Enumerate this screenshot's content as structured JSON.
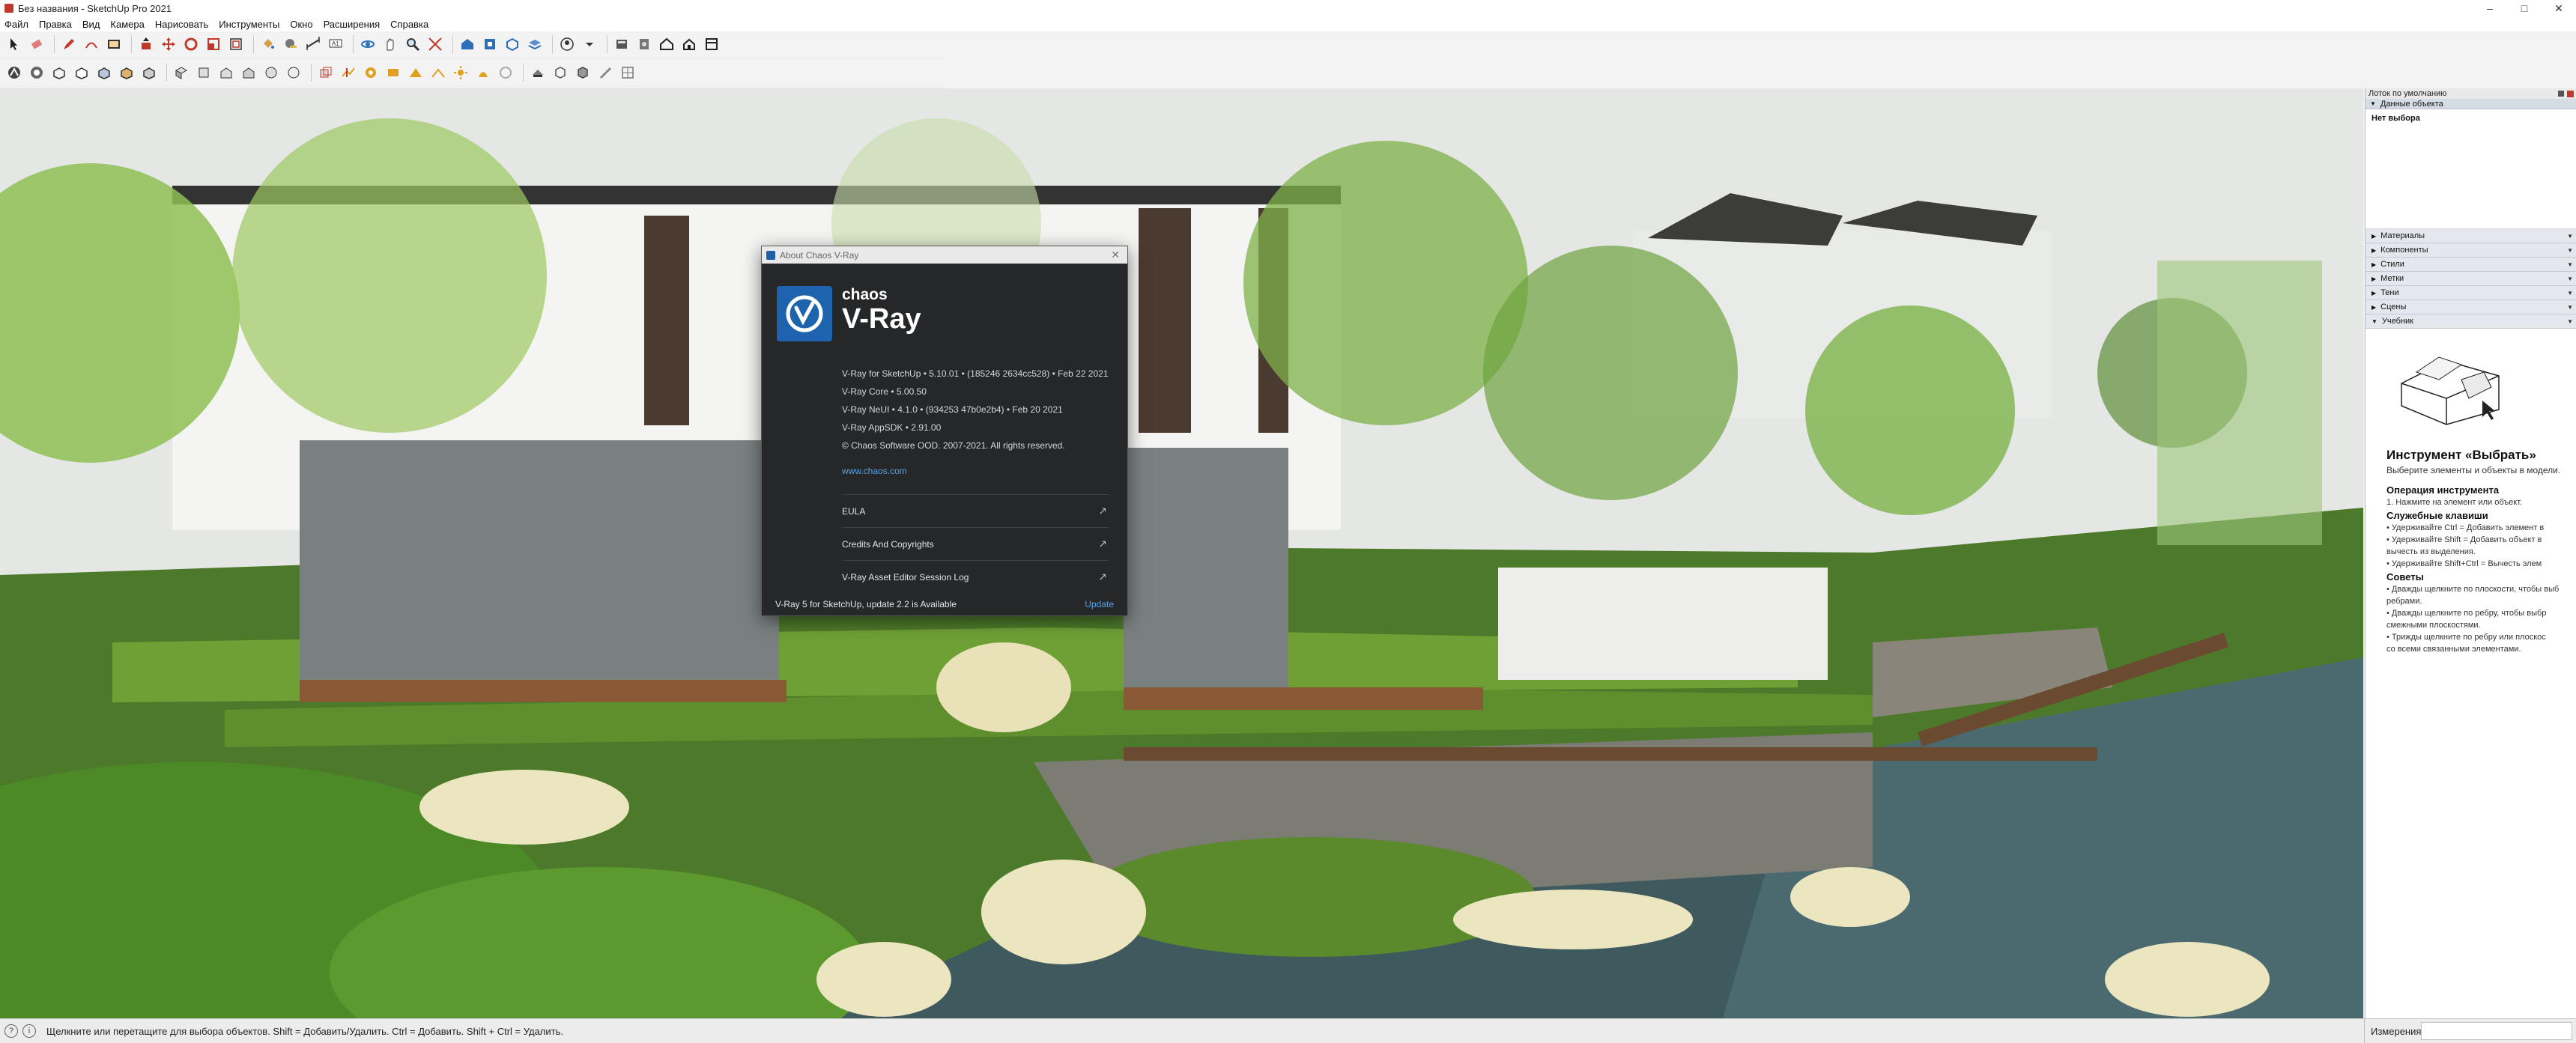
{
  "window": {
    "title": "Без названия - SketchUp Pro 2021",
    "controls": {
      "minimize": "–",
      "maximize": "□",
      "close": "✕"
    }
  },
  "menu": [
    "Файл",
    "Правка",
    "Вид",
    "Камера",
    "Нарисовать",
    "Инструменты",
    "Окно",
    "Расширения",
    "Справка"
  ],
  "toolbar1_icons": [
    "select-icon",
    "eraser-icon",
    "pencil-icon",
    "arc-icon",
    "rectangle-icon",
    "push-pull-icon",
    "move-icon",
    "rotate-icon",
    "scale-icon",
    "offset-icon",
    "paint-bucket-icon",
    "tape-measure-icon",
    "dimension-icon",
    "text-icon",
    "section-plane-icon",
    "orbit-icon",
    "pan-icon",
    "zoom-icon",
    "zoom-extents-icon",
    "warehouse-icon",
    "extension-icon"
  ],
  "toolbar2_icons": [
    "xray-icon",
    "back-edges-icon",
    "wireframe-icon",
    "hidden-line-icon",
    "shaded-icon",
    "textured-icon",
    "monochrome-icon",
    "iso-view-icon",
    "top-view-icon",
    "front-view-icon",
    "right-view-icon",
    "back-view-icon",
    "left-view-icon",
    "sandbox-icon",
    "smoove-icon",
    "stamp-icon",
    "drape-icon",
    "add-detail-icon",
    "flip-edge-icon",
    "solid-union-icon",
    "solid-subtract-icon",
    "solid-trim-icon",
    "camera-icon",
    "walk-icon",
    "look-around-icon",
    "position-camera-icon"
  ],
  "about_dialog": {
    "window_title": "About Chaos V-Ray",
    "brand_small": "chaos",
    "brand_large": "V-Ray",
    "versions": [
      "V-Ray for SketchUp • 5.10.01 • (185246 2634cc528) • Feb 22 2021",
      "V-Ray Core • 5.00.50",
      "V-Ray NeUI • 4.1.0 • (934253 47b0e2b4) • Feb 20 2021",
      "V-Ray AppSDK • 2.91.00",
      "© Chaos Software OOD. 2007-2021. All rights reserved."
    ],
    "website": "www.chaos.com",
    "links": [
      {
        "label": "EULA",
        "arrow": "↗"
      },
      {
        "label": "Credits And Copyrights",
        "arrow": "↗"
      },
      {
        "label": "V-Ray Asset Editor Session Log",
        "arrow": "↗"
      }
    ],
    "update_message": "V-Ray 5 for SketchUp, update 2.2 is Available",
    "update_button": "Update",
    "close": "✕"
  },
  "tray": {
    "title": "Лоток по умолчанию",
    "entity_info": {
      "title": "Данные объекта",
      "status": "Нет выбора"
    },
    "panels": [
      "Материалы",
      "Компоненты",
      "Стили",
      "Метки",
      "Тени",
      "Сцены"
    ],
    "instructor": {
      "panel_title": "Учебник",
      "tool_title": "Инструмент «Выбрать»",
      "tool_subtitle": "Выберите элементы и объекты в модели.",
      "operation_heading": "Операция инструмента",
      "operation_steps": [
        "1. Нажмите на элемент или объект."
      ],
      "modifier_heading": "Служебные клавиши",
      "modifier_lines": [
        "• Удерживайте Ctrl = Добавить элемент в",
        "• Удерживайте Shift = Добавить объект в",
        "   вычесть из выделения.",
        "• Удерживайте Shift+Ctrl = Вычесть элем"
      ],
      "tips_heading": "Советы",
      "tips_lines": [
        "• Дважды щелкните по плоскости, чтобы выб",
        "   ребрами.",
        "• Дважды щелкните по ребру, чтобы выбр",
        "   смежными плоскостями.",
        "• Трижды щелкните по ребру или плоскос",
        "   со всеми связанными элементами."
      ]
    }
  },
  "status_bar": {
    "hint": "Щелкните или перетащите для выбора объектов. Shift = Добавить/Удалить. Ctrl = Добавить. Shift + Ctrl = Удалить.",
    "measurements_label": "Измерения",
    "icons": [
      "info-icon",
      "help-icon"
    ],
    "icon_glyphs": [
      "?",
      "i"
    ]
  }
}
